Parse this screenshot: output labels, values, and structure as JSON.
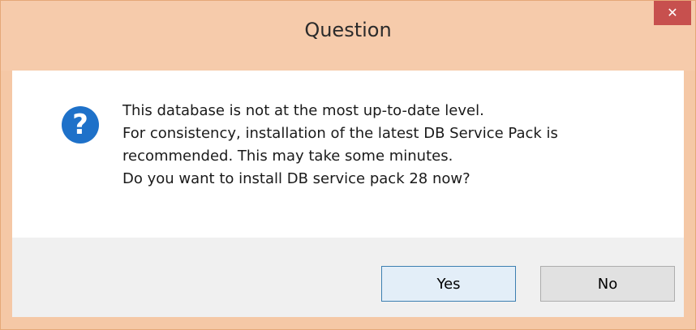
{
  "window": {
    "title": "Question",
    "close_glyph": "✕"
  },
  "icon": {
    "name": "question-icon",
    "glyph": "?",
    "color": "#1e71c9"
  },
  "message": {
    "lines": [
      "This database is not at the most up-to-date level.",
      "For consistency, installation of the latest DB Service Pack is",
      "recommended. This may take some minutes.",
      "Do you want to install DB service pack 28 now?"
    ]
  },
  "buttons": {
    "yes_label": "Yes",
    "no_label": "No"
  },
  "colors": {
    "titlebar": "#f6cbab",
    "close_button": "#c7504e",
    "button_panel": "#f0f0f0"
  }
}
